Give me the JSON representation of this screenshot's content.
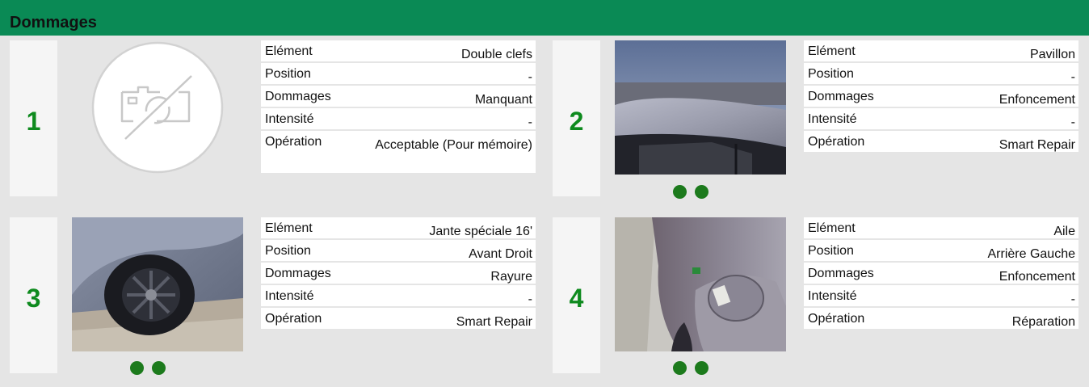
{
  "header": {
    "title": "Dommages"
  },
  "labels": {
    "element": "Elément",
    "position": "Position",
    "dommages": "Dommages",
    "intensite": "Intensité",
    "operation": "Opération"
  },
  "cards": [
    {
      "number": "1",
      "photo": "no-photo-placeholder-icon",
      "element": "Double clefs",
      "position": "-",
      "dommages": "Manquant",
      "intensite": "-",
      "operation": "Acceptable (Pour mémoire)"
    },
    {
      "number": "2",
      "photo": "car-roof-photo",
      "element": "Pavillon",
      "position": "-",
      "dommages": "Enfoncement",
      "intensite": "-",
      "operation": "Smart Repair"
    },
    {
      "number": "3",
      "photo": "car-wheel-photo",
      "element": "Jante spéciale 16'",
      "position": "Avant Droit",
      "dommages": "Rayure",
      "intensite": "-",
      "operation": "Smart Repair"
    },
    {
      "number": "4",
      "photo": "car-rear-wing-photo",
      "element": "Aile",
      "position": "Arrière Gauche",
      "dommages": "Enfoncement",
      "intensite": "-",
      "operation": "Réparation"
    }
  ],
  "colors": {
    "header": "#0a8a55",
    "number": "#0e8a1e",
    "dot": "#1c7a1c",
    "background": "#e5e5e5"
  }
}
